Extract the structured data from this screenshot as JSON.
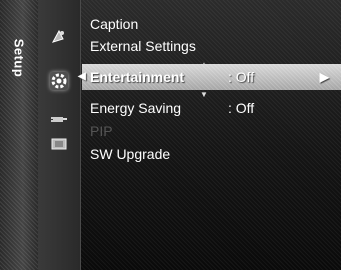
{
  "menu": {
    "section_title": "Setup",
    "items": [
      {
        "label": "Caption",
        "value": ""
      },
      {
        "label": "External Settings",
        "value": ""
      },
      {
        "label": "Entertainment",
        "value": ": Off"
      },
      {
        "label": "Energy Saving",
        "value": ": Off"
      },
      {
        "label": "PIP",
        "value": "",
        "disabled": true
      },
      {
        "label": "SW Upgrade",
        "value": ""
      }
    ],
    "selected_index": 2
  },
  "icons": [
    "satellite-dish-icon",
    "gear-icon",
    "plug-icon",
    "film-icon"
  ],
  "colors": {
    "background": "#151515",
    "highlight": "#c0c0c0",
    "text": "#ffffff",
    "disabled_text": "#555555"
  }
}
